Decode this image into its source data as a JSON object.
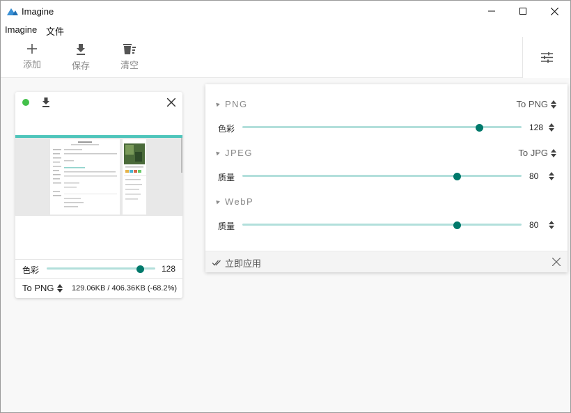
{
  "window": {
    "title": "Imagine",
    "controls": [
      "minimize-icon",
      "maximize-icon",
      "close-icon"
    ]
  },
  "menu": {
    "items": [
      "Imagine",
      "文件"
    ]
  },
  "toolbar": {
    "add_label": "添加",
    "save_label": "保存",
    "clear_label": "清空",
    "settings_icon": "sliders-icon"
  },
  "card": {
    "status": "done",
    "status_color": "#43c04a",
    "color_label": "色彩",
    "color_value": "128",
    "color_slider_fraction": 0.86,
    "format": "To PNG",
    "size_info": "129.06KB / 406.36KB (-68.2%)"
  },
  "panel": {
    "sections": [
      {
        "name": "PNG",
        "format": "To PNG",
        "label": "色彩",
        "value": "128",
        "fraction": 0.85
      },
      {
        "name": "JPEG",
        "format": "To JPG",
        "label": "质量",
        "value": "80",
        "fraction": 0.77
      },
      {
        "name": "WebP",
        "format": "",
        "label": "质量",
        "value": "80",
        "fraction": 0.77
      }
    ],
    "apply_label": "立即应用"
  },
  "colors": {
    "accent": "#00796b",
    "track": "#b2dfdb",
    "status_green": "#43c04a"
  }
}
